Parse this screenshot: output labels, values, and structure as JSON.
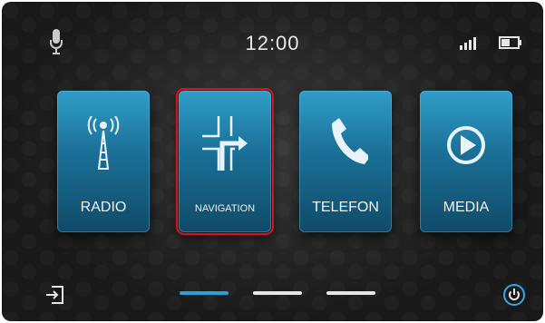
{
  "status": {
    "time": "12:00",
    "icons": [
      "microphone-icon",
      "signal-strength-icon",
      "battery-icon"
    ]
  },
  "tiles": [
    {
      "label": "RADIO",
      "icon": "radio-tower-icon"
    },
    {
      "label": "NAVIGATION",
      "icon": "navigation-arrow-icon",
      "selected": true
    },
    {
      "label": "TELEFON",
      "icon": "phone-handset-icon"
    },
    {
      "label": "MEDIA",
      "icon": "play-circle-icon"
    }
  ],
  "pager": {
    "count": 3,
    "active_index": 0
  },
  "bottom_icons": [
    "exit-icon",
    "power-icon"
  ],
  "colors": {
    "tile_top": "#2f9dc9",
    "tile_bottom": "#104a68",
    "selection": "#d9121b",
    "pager_active": "#2b9fd6",
    "pager_inactive": "#e6e6e6",
    "power_accent": "#3aa7e0"
  }
}
